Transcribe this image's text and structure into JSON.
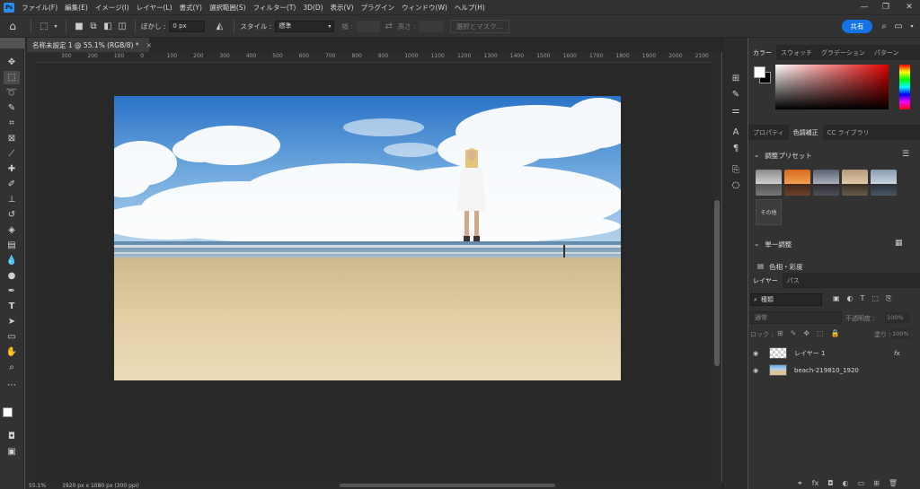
{
  "menu": {
    "logo": "Ps",
    "items": [
      "ファイル(F)",
      "編集(E)",
      "イメージ(I)",
      "レイヤー(L)",
      "書式(Y)",
      "選択範囲(S)",
      "フィルター(T)",
      "3D(D)",
      "表示(V)",
      "プラグイン",
      "ウィンドウ(W)",
      "ヘルプ(H)"
    ]
  },
  "options": {
    "feather_label": "ぼかし :",
    "feather_value": "0 px",
    "style_label": "スタイル :",
    "style_value": "標準",
    "width_label": "幅 :",
    "height_label": "高さ :",
    "select_mask": "選択とマスク...",
    "share": "共有"
  },
  "document": {
    "tab_title": "名称未設定 1 @ 55.1% (RGB/8) *",
    "close": "×"
  },
  "ruler": {
    "top_labels": [
      "300",
      "200",
      "100",
      "0",
      "100",
      "200",
      "300",
      "400",
      "500",
      "600",
      "700",
      "800",
      "900",
      "1000",
      "1100",
      "1200",
      "1300",
      "1400",
      "1500",
      "1600",
      "1700",
      "1800",
      "1900",
      "2000",
      "2100",
      "2200"
    ]
  },
  "status": {
    "zoom": "55.1%",
    "doc_info": "1920 px x 1080 px (300 ppi)"
  },
  "panels": {
    "color_tabs": [
      "カラー",
      "スウォッチ",
      "グラデーション",
      "パターン"
    ],
    "adjust_tabs": [
      "プロパティ",
      "色調補正",
      "CC ライブラリ"
    ],
    "presets_title": "調整プリセット",
    "more_label": "その他",
    "single_title": "単一調整",
    "hue_label": "色相・彩度",
    "layer_tabs": [
      "レイヤー",
      "パス"
    ],
    "kind_label": "種類",
    "blend_mode": "通常",
    "opacity_label": "不透明度 :",
    "opacity_value": "100%",
    "lock_label": "ロック :",
    "fill_label": "塗り :",
    "fill_value": "100%",
    "layers": [
      {
        "name": "レイヤー 1",
        "fx": "fx"
      },
      {
        "name": "beach-219810_1920"
      }
    ]
  },
  "colors": {
    "accent": "#1473e6",
    "panel": "#323232",
    "canvas": "#282828"
  }
}
